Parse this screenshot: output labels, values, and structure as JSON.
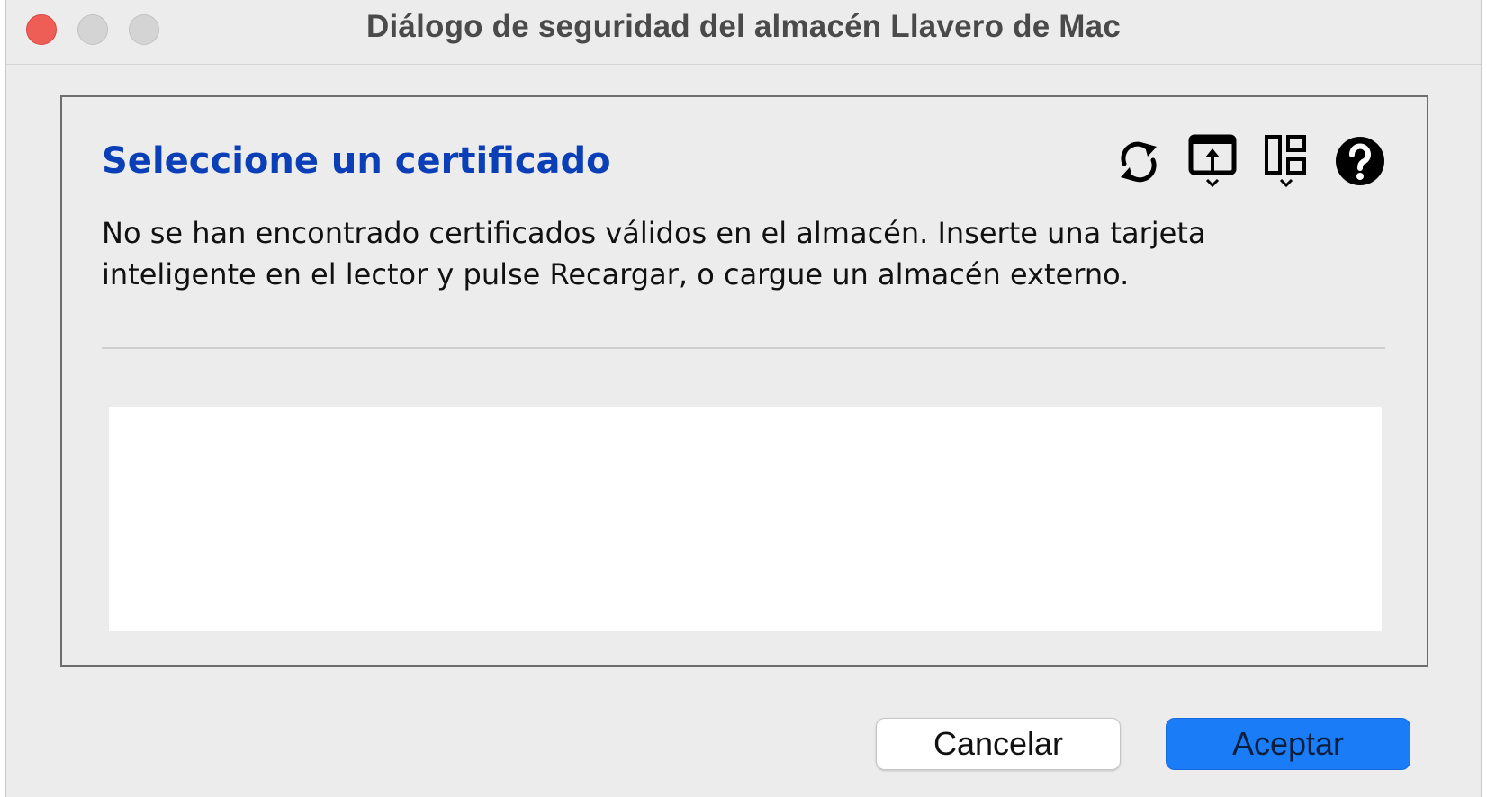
{
  "window": {
    "title": "Diálogo de seguridad del almacén Llavero de Mac"
  },
  "panel": {
    "heading": "Seleccione un certificado",
    "description_line1": "No se han encontrado certificados válidos en el almacén. Inserte una tarjeta",
    "description_line2": "inteligente en el lector y pulse Recargar, o cargue un almacén externo.",
    "heading_color": "#0b3fb8",
    "toolbar": [
      {
        "icon": "refresh-icon"
      },
      {
        "icon": "open-external-store-icon"
      },
      {
        "icon": "view-options-icon"
      },
      {
        "icon": "help-icon"
      }
    ],
    "certificates": []
  },
  "buttons": {
    "cancel_label": "Cancelar",
    "accept_label": "Aceptar",
    "accept_color": "#1a7cf6"
  }
}
